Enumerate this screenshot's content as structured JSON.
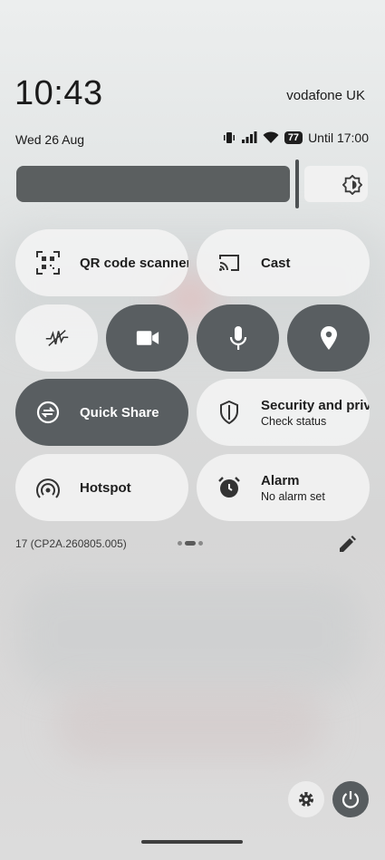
{
  "status_bar": {
    "time": "10:43",
    "carrier": "vodafone UK",
    "date": "Wed 26 Aug",
    "battery": "77",
    "battery_text": "Until 17:00"
  },
  "brightness": {
    "level_fraction": 0.78
  },
  "tiles": [
    {
      "label": "QR code scanner",
      "sub": "",
      "icon": "qr-code-icon",
      "active": false
    },
    {
      "label": "Cast",
      "sub": "",
      "icon": "cast-icon",
      "active": false
    },
    {
      "label": "Mobile data",
      "sub": "",
      "icon": "data-saver-icon",
      "active": false
    },
    {
      "label": "Camera access",
      "sub": "",
      "icon": "camera-icon",
      "active": true
    },
    {
      "label": "Microphone access",
      "sub": "",
      "icon": "microphone-icon",
      "active": true
    },
    {
      "label": "Location",
      "sub": "",
      "icon": "location-pin-icon",
      "active": true
    },
    {
      "label": "Quick Share",
      "sub": "",
      "icon": "quick-share-icon",
      "active": true
    },
    {
      "label": "Security and privacy",
      "sub": "Check status",
      "icon": "shield-icon",
      "active": false
    },
    {
      "label": "Hotspot",
      "sub": "",
      "icon": "hotspot-icon",
      "active": false
    },
    {
      "label": "Alarm",
      "sub": "No alarm set",
      "icon": "alarm-icon",
      "active": false
    }
  ],
  "footer": {
    "build": "17 (CP2A.260805.005)",
    "page_count": 3,
    "current_page": 2
  },
  "colors": {
    "active_tile": "#595e61",
    "inactive_tile": "#f5f5f5"
  }
}
